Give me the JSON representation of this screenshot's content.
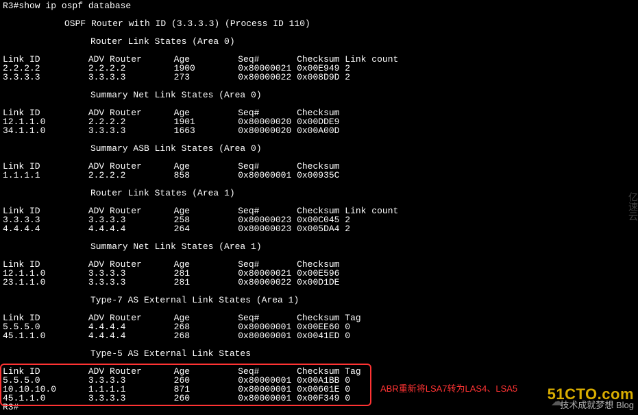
{
  "cmd": "R3#show ip ospf database",
  "header": "OSPF Router with ID (3.3.3.3) (Process ID 110)",
  "section1_title": "Router Link States (Area 0)",
  "hdr_full": "Link ID         ADV Router      Age         Seq#       Checksum Link count",
  "s1_r1": "2.2.2.2         2.2.2.2         1900        0x80000021 0x00E949 2",
  "s1_r2": "3.3.3.3         3.3.3.3         273         0x80000022 0x008D9D 2",
  "section2_title": "Summary Net Link States (Area 0)",
  "hdr_short": "Link ID         ADV Router      Age         Seq#       Checksum",
  "s2_r1": "12.1.1.0        2.2.2.2         1901        0x80000020 0x00DDE9",
  "s2_r2": "34.1.1.0        3.3.3.3         1663        0x80000020 0x00A00D",
  "section3_title": "Summary ASB Link States (Area 0)",
  "s3_r1": "1.1.1.1         2.2.2.2         858         0x80000001 0x00935C",
  "section4_title": "Router Link States (Area 1)",
  "s4_r1": "3.3.3.3         3.3.3.3         258         0x80000023 0x00C045 2",
  "s4_r2": "4.4.4.4         4.4.4.4         264         0x80000023 0x005DA4 2",
  "section5_title": "Summary Net Link States (Area 1)",
  "s5_r1": "12.1.1.0        3.3.3.3         281         0x80000021 0x00E596",
  "s5_r2": "23.1.1.0        3.3.3.3         281         0x80000022 0x00D1DE",
  "section6_title": "Type-7 AS External Link States (Area 1)",
  "hdr_tag": "Link ID         ADV Router      Age         Seq#       Checksum Tag",
  "s6_r1": "5.5.5.0         4.4.4.4         268         0x80000001 0x00EE60 0",
  "s6_r2": "45.1.1.0        4.4.4.4         268         0x80000001 0x0041ED 0",
  "section7_title": "Type-5 AS External Link States",
  "s7_r1": "5.5.5.0         3.3.3.3         260         0x80000001 0x00A1BB 0",
  "s7_r2": "10.10.10.0      1.1.1.1         871         0x80000001 0x00601E 0",
  "s7_r3": "45.1.1.0        3.3.3.3         260         0x80000001 0x00F349 0",
  "prompt": "R3#",
  "annotation": "ABR重新将LSA7转为LAS4、LSA5",
  "watermark": "51CTO.com",
  "watermark_sub": "技术成就梦想  Blog",
  "ysy_text": "亿速云"
}
